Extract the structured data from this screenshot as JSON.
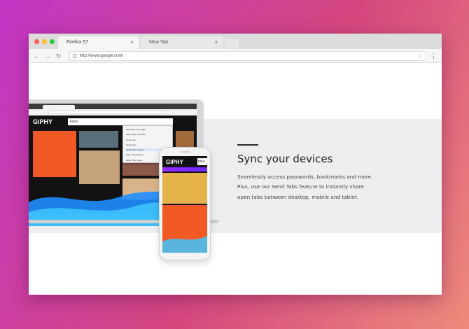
{
  "browser": {
    "tabs": [
      {
        "label": "Firefox 57",
        "active": true
      },
      {
        "label": "New Tab",
        "active": false
      }
    ],
    "close_glyph": "×",
    "url": "http://www.google.com/",
    "nav": {
      "back": "←",
      "forward": "→",
      "reload": "↻"
    },
    "star": "☆",
    "menu": "⋮",
    "traffic_colors": [
      "#fd5f57",
      "#febc2e",
      "#27c840"
    ]
  },
  "hero": {
    "heading": "Sync your devices",
    "description_lines": [
      "Seamlessly access passwords, bookmarks and more.",
      "Plus, use our Send Tabs feature to instantly share",
      "open tabs between desktop, mobile and tablet."
    ]
  },
  "illustration": {
    "laptop_logo": "GIPHY",
    "laptop_search": "Fries",
    "phone_logo": "GIPHY",
    "phone_search": "fries",
    "context_menu": [
      "Bookmark This Page",
      "Save Page to Pocket",
      "Copy Link",
      "Email Link...",
      "Send Tab to Device",
      "Take a Screenshot",
      "Report Site Issue..."
    ]
  }
}
